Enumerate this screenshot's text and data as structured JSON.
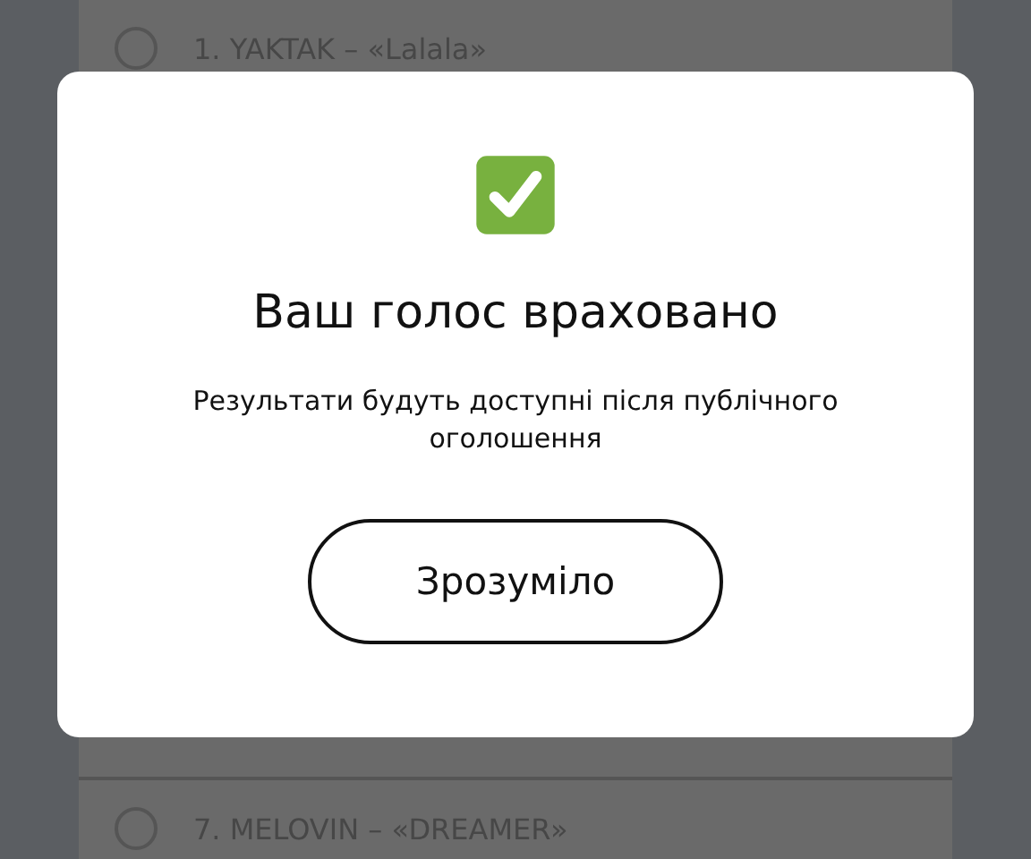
{
  "options": [
    {
      "label": "1. YAKTAK – «Lalala»",
      "selected": false
    },
    {
      "label": "7. MELOVIN – «DREAMER»",
      "selected": false
    }
  ],
  "dialog": {
    "title": "Ваш голос враховано",
    "message": "Результати будуть доступні після публічного оголошення",
    "button": "Зрозуміло"
  }
}
